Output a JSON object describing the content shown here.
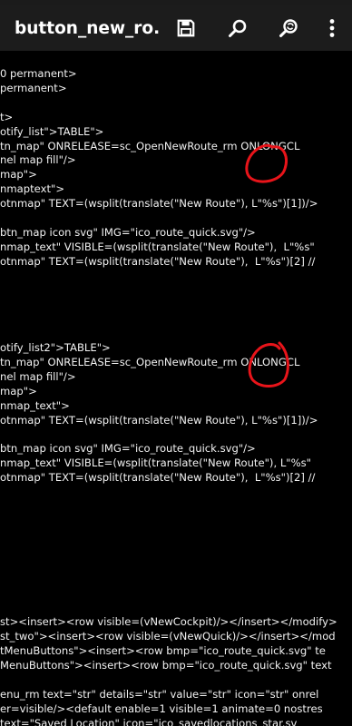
{
  "toolbar": {
    "title": "button_new_ro...",
    "icons": [
      "save-icon",
      "search-icon",
      "search-replace-icon",
      "more-vert-icon"
    ]
  },
  "editor": {
    "lines": [
      "0 permanent>",
      "permanent>",
      "",
      "t>",
      "otify_list\">TABLE\">",
      "tn_map\" ONRELEASE=sc_OpenNewRoute_rm ONLONGCL",
      "nel map fill\"/>",
      "map\">",
      "nmaptext\">",
      "otnmap\" TEXT=(wsplit(translate(\"New Route\"), L\"%s\")[1])/>",
      "",
      "btn_map icon svg\" IMG=\"ico_route_quick.svg\"/>",
      "nmap_text\" VISIBLE=(wsplit(translate(\"New Route\"),  L\"%s\"",
      "otnmap\" TEXT=(wsplit(translate(\"New Route\"),  L\"%s\")[2] //",
      "",
      "",
      "",
      "",
      "",
      "otify_list2\">TABLE\">",
      "tn_map\" ONRELEASE=sc_OpenNewRoute_rm ONLONGCL",
      "nel map fill\"/>",
      "map\">",
      "nmap_text\">",
      "otnmap\" TEXT=(wsplit(translate(\"New Route\"), L\"%s\")[1])/>",
      "",
      "btn_map icon svg\" IMG=\"ico_route_quick.svg\"/>",
      "nmap_text\" VISIBLE=(wsplit(translate(\"New Route\"), L\"%s\"",
      "otnmap\" TEXT=(wsplit(translate(\"New Route\"),  L\"%s\")[2] //",
      "",
      "",
      "",
      "",
      "",
      "",
      "",
      "",
      "",
      "st><insert><row visible=(vNewCockpit)/></insert></modify>",
      "st_two\"><insert><row visible=(vNewQuick)/></insert></mod",
      "tMenuButtons\"><insert><row bmp=\"ico_route_quick.svg\" te",
      "MenuButtons\"><insert><row bmp=\"ico_route_quick.svg\" text",
      "",
      "enu_rm text=\"str\" details=\"str\" value=\"str\" icon=\"str\" onrel",
      "er=visible/><default enable=1 visible=1 animate=0 nostres",
      "text=\"Saved Location\" icon=\"ico_savedlocations_star.sv"
    ]
  },
  "annotations": {
    "color": "#e8141a"
  }
}
